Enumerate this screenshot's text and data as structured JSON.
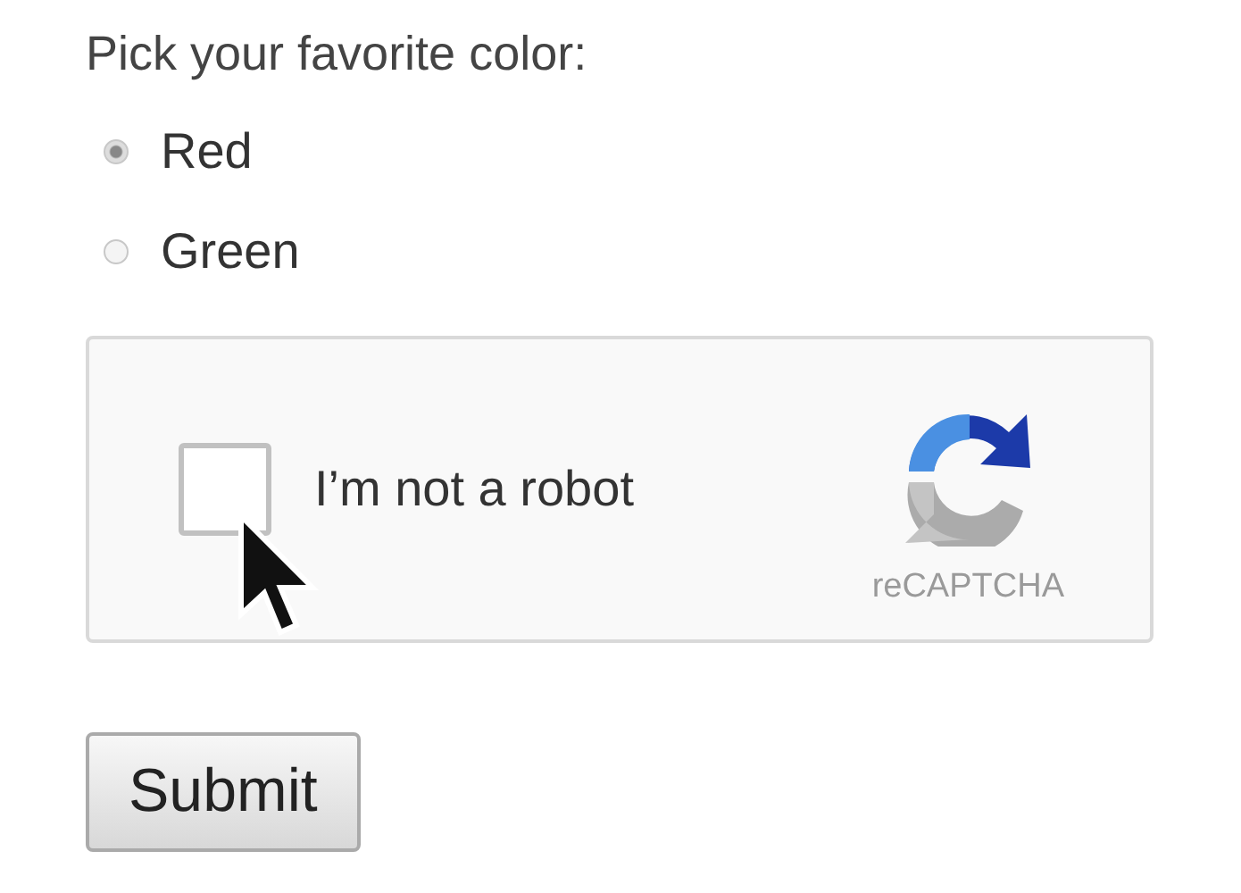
{
  "question": "Pick your favorite color:",
  "options": [
    {
      "label": "Red",
      "selected": true
    },
    {
      "label": "Green",
      "selected": false
    }
  ],
  "captcha": {
    "label": "I’m not a robot",
    "checked": false,
    "brand": "reCAPTCHA"
  },
  "buttons": [
    "Submit"
  ]
}
